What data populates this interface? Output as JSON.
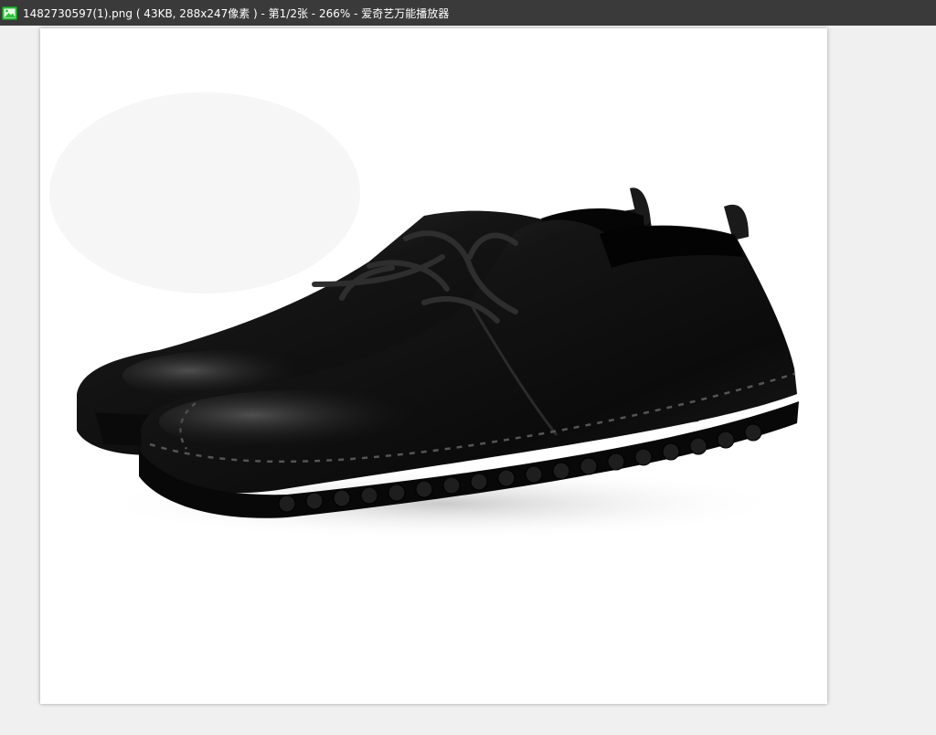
{
  "window": {
    "title": "1482730597(1).png ( 43KB, 288x247像素 ) - 第1/2张 - 266% - 爱奇艺万能播放器",
    "icon": "image-file-icon"
  },
  "viewer": {
    "image_subject": "shoe-photo",
    "background_color": "#f0f0f0",
    "titlebar_color": "#3a3a3a",
    "icon_color": "#2fbf3a"
  }
}
